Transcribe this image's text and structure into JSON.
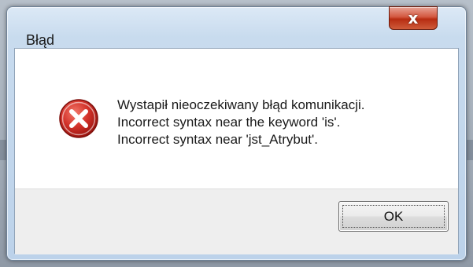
{
  "dialog": {
    "title": "Błąd",
    "close_glyph": "x",
    "icon": "error-icon",
    "message_lines": [
      "Wystapił nieoczekiwany błąd komunikacji.",
      "Incorrect syntax near the keyword 'is'.",
      "Incorrect syntax near 'jst_Atrybut'."
    ],
    "ok_label": "OK"
  },
  "colors": {
    "close_button": "#c8442a",
    "error_icon": "#c4231b",
    "button_area": "#eeeeee"
  }
}
